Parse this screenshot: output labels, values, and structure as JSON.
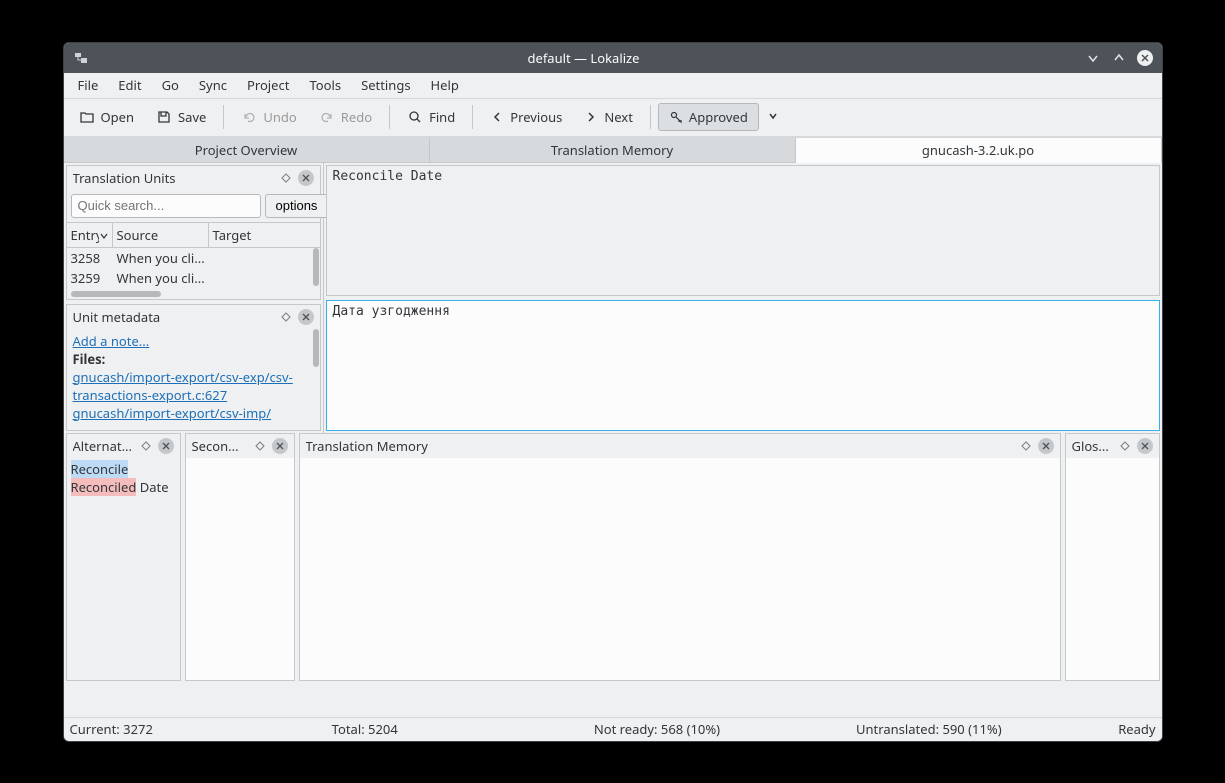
{
  "title": "default — Lokalize",
  "menubar": [
    "File",
    "Edit",
    "Go",
    "Sync",
    "Project",
    "Tools",
    "Settings",
    "Help"
  ],
  "toolbar": {
    "open": "Open",
    "save": "Save",
    "undo": "Undo",
    "redo": "Redo",
    "find": "Find",
    "previous": "Previous",
    "next": "Next",
    "approved": "Approved"
  },
  "tabs": {
    "overview": "Project Overview",
    "tm": "Translation Memory",
    "file": "gnucash-3.2.uk.po",
    "active": 2
  },
  "translation_units": {
    "title": "Translation Units",
    "search_placeholder": "Quick search...",
    "options_label": "options",
    "columns": {
      "entry": "Entry",
      "source": "Source",
      "target": "Target"
    },
    "rows": [
      {
        "entry": "3258",
        "source": "When you cli..."
      },
      {
        "entry": "3259",
        "source": "When you cli..."
      }
    ]
  },
  "unit_metadata": {
    "title": "Unit metadata",
    "add_note": "Add a note...",
    "files_label": "Files:",
    "files": [
      "gnucash/import-export/csv-exp/csv-transactions-export.c:627",
      "gnucash/import-export/csv-imp/"
    ]
  },
  "editor": {
    "source": "Reconcile Date",
    "target": "Дата узгодження"
  },
  "lower_panels": {
    "alt": "Alternat...",
    "sec": "Secon...",
    "tm": "Translation Memory",
    "glos": "Glos..."
  },
  "alternate": {
    "inserted": "Reconcile",
    "deleted": "Reconciled",
    "tail": " Date"
  },
  "status": {
    "current": "Current: 3272",
    "total": "Total: 5204",
    "not_ready": "Not ready: 568 (10%)",
    "untranslated": "Untranslated: 590 (11%)",
    "ready": "Ready"
  }
}
